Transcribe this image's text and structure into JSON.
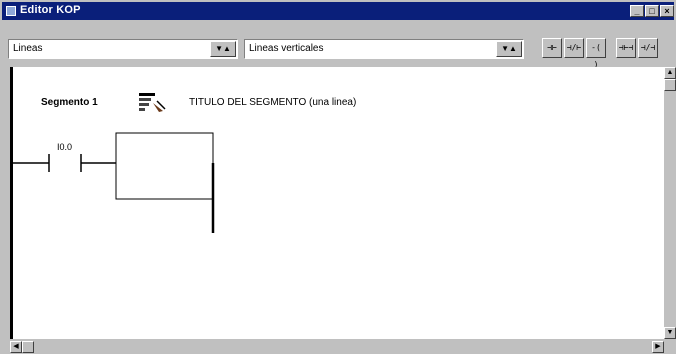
{
  "window": {
    "title": "Editor KOP"
  },
  "title_buttons": {
    "minimize": "_",
    "maximize": "□",
    "close": "×"
  },
  "toolbar": {
    "combo1": {
      "value": "Lineas"
    },
    "combo2": {
      "value": "Lineas verticales"
    },
    "tools": [
      "⊣⊢",
      "⊣/⊢",
      "-( )",
      "⊣⊢⊣",
      "⊣/⊣"
    ]
  },
  "segment": {
    "label": "Segmento 1",
    "title": "TITULO DEL SEGMENTO (una linea)",
    "icon": "segment-comment-icon"
  },
  "ladder": {
    "contact_address": "I0.0"
  },
  "colors": {
    "titlebar": "#0a1f7a",
    "chrome": "#c0c0c0",
    "canvas": "#ffffff",
    "ink": "#000000"
  }
}
